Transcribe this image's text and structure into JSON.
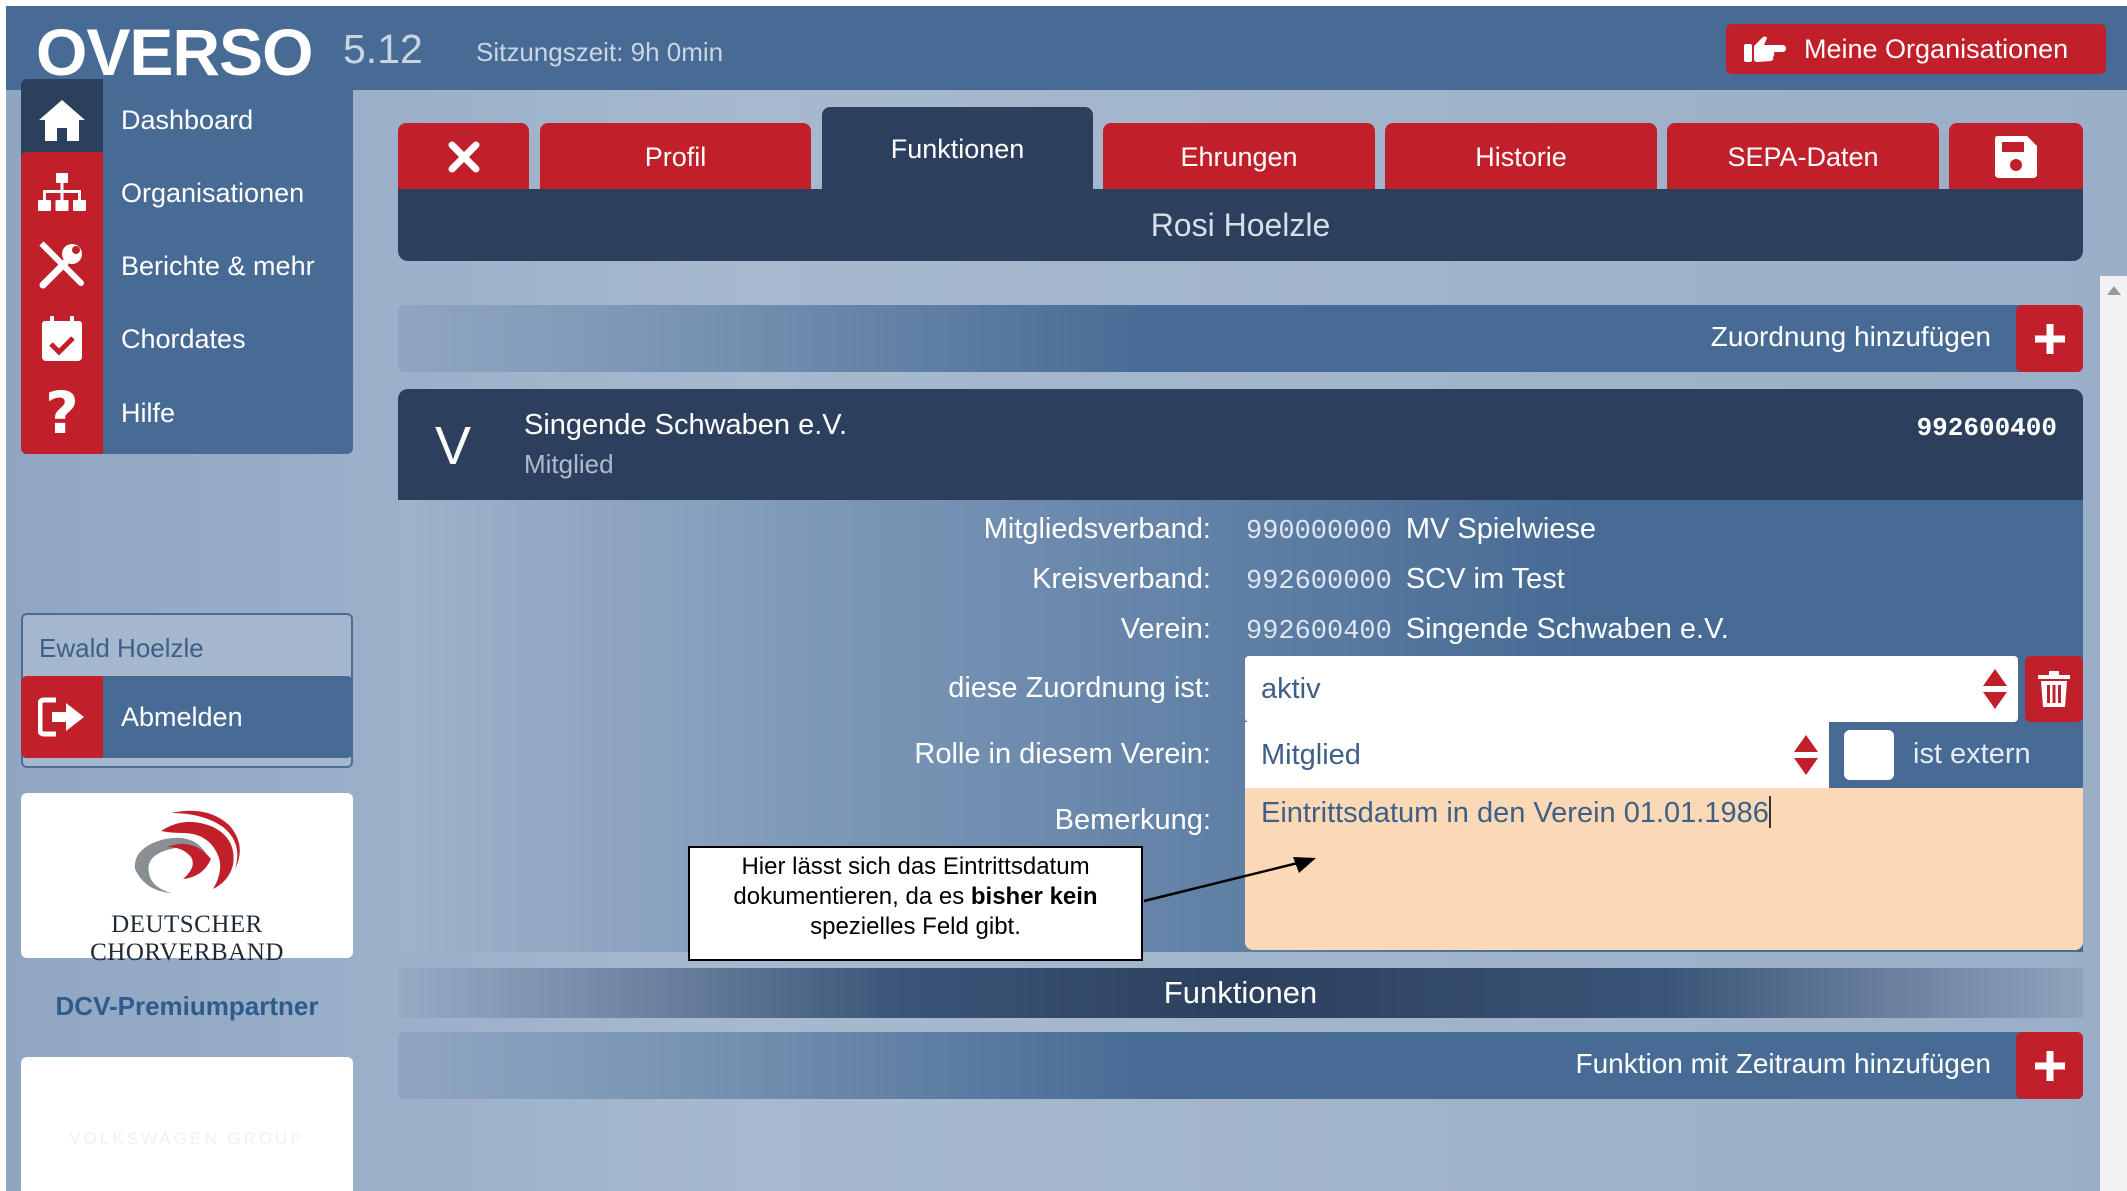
{
  "app": {
    "logo": "OVERSO",
    "version": "5.12",
    "session": "Sitzungszeit: 9h 0min",
    "my_orgs_label": "Meine Organisationen",
    "accent_color": "#c1202a",
    "navy_color": "#2c405d"
  },
  "sidebar": {
    "items": [
      {
        "label": "Dashboard",
        "icon": "home-icon"
      },
      {
        "label": "Organisationen",
        "icon": "org-chart-icon"
      },
      {
        "label": "Berichte & mehr",
        "icon": "tools-icon"
      },
      {
        "label": "Chordates",
        "icon": "calendar-check-icon"
      },
      {
        "label": "Hilfe",
        "icon": "question-icon"
      }
    ],
    "user_name": "Ewald Hoelzle",
    "logout_label": "Abmelden",
    "partner_logo_text": "Deutscher Chorverband",
    "premium_label": "DCV-Premiumpartner",
    "partner2_text": "VOLKSWAGEN GROUP"
  },
  "tabs": [
    {
      "label": "",
      "icon": "close-icon"
    },
    {
      "label": "Profil"
    },
    {
      "label": "Funktionen",
      "active": true
    },
    {
      "label": "Ehrungen"
    },
    {
      "label": "Historie"
    },
    {
      "label": "SEPA-Daten"
    },
    {
      "label": "",
      "icon": "save-icon"
    }
  ],
  "person_name": "Rosi Hoelzle",
  "add_assignment_label": "Zuordnung hinzufügen",
  "assignment": {
    "badge": "V",
    "org_name": "Singende Schwaben e.V.",
    "role": "Mitglied",
    "number": "992600400",
    "fields": {
      "mitgliedsverband_label": "Mitgliedsverband:",
      "mitgliedsverband_num": "990000000",
      "mitgliedsverband_name": "MV Spielwiese",
      "kreisverband_label": "Kreisverband:",
      "kreisverband_num": "992600000",
      "kreisverband_name": "SCV im Test",
      "verein_label": "Verein:",
      "verein_num": "992600400",
      "verein_name": "Singende Schwaben e.V.",
      "status_label": "diese Zuordnung ist:",
      "status_value": "aktiv",
      "role_label": "Rolle in diesem Verein:",
      "role_value": "Mitglied",
      "extern_label": "ist extern",
      "remark_label": "Bemerkung:",
      "remark_value": "Eintrittsdatum in den Verein 01.01.1986"
    }
  },
  "callout": {
    "line1": "Hier lässt sich das Eintrittsdatum",
    "line2_a": "dokumentieren, da es ",
    "line2_b": "bisher kein",
    "line3": "spezielles Feld gibt."
  },
  "functions_header": "Funktionen",
  "add_function_label": "Funktion mit Zeitraum hinzufügen"
}
